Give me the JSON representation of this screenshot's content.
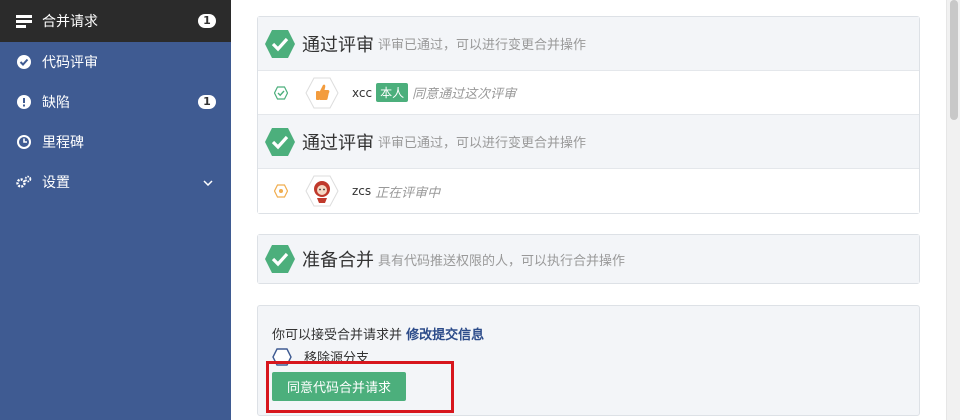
{
  "sidebar": {
    "items": [
      {
        "label": "合并请求",
        "badge": "1",
        "icon": "list-icon"
      },
      {
        "label": "代码评审",
        "icon": "check-circle-icon"
      },
      {
        "label": "缺陷",
        "badge": "1",
        "icon": "exclamation-icon"
      },
      {
        "label": "里程碑",
        "icon": "clock-icon"
      },
      {
        "label": "设置",
        "icon": "gear-icon"
      }
    ]
  },
  "reviews": [
    {
      "title": "通过评审",
      "desc": "评审已通过，可以进行变更合并操作",
      "user": "xcc",
      "owner_badge": "本人",
      "status": "同意通过这次评审"
    },
    {
      "title": "通过评审",
      "desc": "评审已通过，可以进行变更合并操作",
      "user": "zcs",
      "status": "正在评审中"
    }
  ],
  "ready": {
    "title": "准备合并",
    "desc": "具有代码推送权限的人，可以执行合并操作"
  },
  "merge": {
    "text": "你可以接受合并请求并",
    "link": "修改提交信息",
    "remove_branch": "移除源分支",
    "accept_button": "同意代码合并请求"
  },
  "colors": {
    "sidebar": "#3f5b92",
    "sidebar_active": "#2b2b2b",
    "accent_green": "#4caf7c",
    "highlight": "#d7161d"
  }
}
